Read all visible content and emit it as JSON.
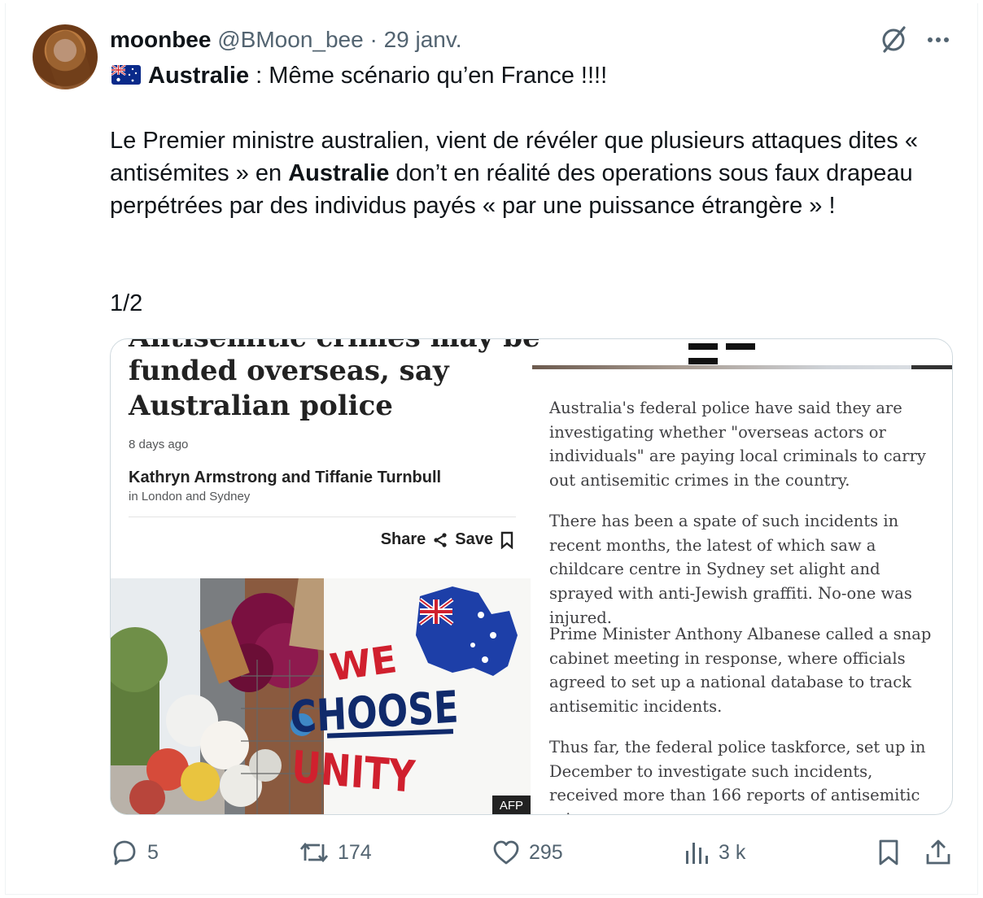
{
  "author": {
    "display_name": "moonbee",
    "handle": "@BMoon_bee",
    "separator": "·",
    "date": "29 janv."
  },
  "icons": {
    "grok": "grok-slashed-circle-icon",
    "more": "more-dots-icon",
    "flag": "australia-flag-icon",
    "reply": "reply-bubble-icon",
    "repost": "repost-arrows-icon",
    "like": "heart-icon",
    "views": "bar-chart-icon",
    "bookmark": "bookmark-icon",
    "share": "share-upload-icon"
  },
  "tweet": {
    "line1_bold": "Australie",
    "line1_rest": " : Même scénario qu’en France !!!!",
    "body_part1": "Le Premier ministre australien, vient de révéler que plusieurs attaques dites « antisémites » en ",
    "body_bold": "Australie",
    "body_part2": " don’t en réalité des operations sous faux drapeau perpétrées par des individus payés « par une puissance étrangère » !",
    "thread_count": "1/2"
  },
  "article": {
    "clipped_headline": "Antisemitic crimes may be",
    "headline": "funded overseas, say Australian police",
    "age": "8 days ago",
    "authors": "Kathryn Armstrong and Tiffanie Turnbull",
    "location": "in London and Sydney",
    "share_label": "Share",
    "save_label": "Save",
    "photo_sign_top": "WE",
    "photo_sign_mid": "CHOOSE",
    "photo_sign_bottom": "UNITY",
    "photo_credit": "AFP",
    "paragraphs": [
      "Australia's federal police have said they are investigating whether \"overseas actors or individuals\" are paying local criminals to carry out antisemitic crimes in the country.",
      "There has been a spate of such incidents in recent months, the latest of which saw a childcare centre in Sydney set alight and sprayed with anti-Jewish graffiti. No-one was injured.",
      "Prime Minister Anthony Albanese called a snap cabinet meeting in response, where officials agreed to set up a national database to track antisemitic incidents.",
      "Thus far, the federal police taskforce, set up in December to investigate such incidents, received more than 166 reports of antisemitic crimes."
    ]
  },
  "actions": {
    "replies": "5",
    "reposts": "174",
    "likes": "295",
    "views": "3 k"
  },
  "colors": {
    "text": "#0f1419",
    "muted": "#536471",
    "border": "#cfd9de",
    "sign_red": "#d0202e",
    "sign_blue": "#102a6b"
  }
}
